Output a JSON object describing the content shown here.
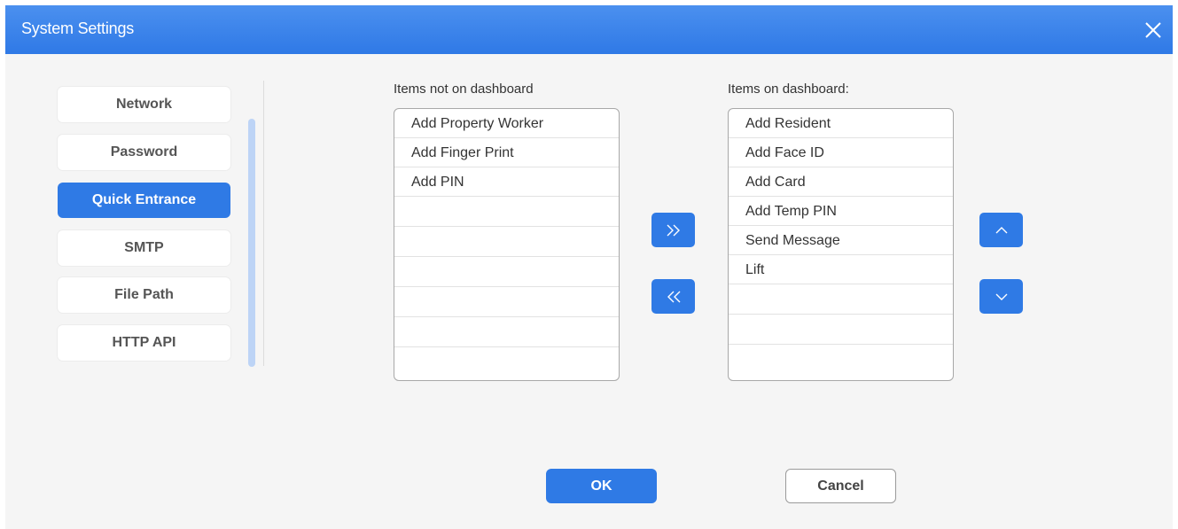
{
  "window": {
    "title": "System Settings"
  },
  "sidebar": {
    "items": [
      {
        "label": "Network",
        "active": false
      },
      {
        "label": "Password",
        "active": false
      },
      {
        "label": "Quick Entrance",
        "active": true
      },
      {
        "label": "SMTP",
        "active": false
      },
      {
        "label": "File Path",
        "active": false
      },
      {
        "label": "HTTP API",
        "active": false
      }
    ]
  },
  "lists": {
    "available": {
      "label": "Items not on dashboard",
      "items": [
        "Add Property Worker",
        "Add Finger Print",
        "Add PIN"
      ]
    },
    "dashboard": {
      "label": "Items on dashboard:",
      "items": [
        "Add Resident",
        "Add Face ID",
        "Add Card",
        "Add Temp PIN",
        "Send Message",
        "Lift"
      ]
    }
  },
  "buttons": {
    "ok_label": "OK",
    "cancel_label": "Cancel"
  },
  "icons": {
    "close": "close-icon",
    "add": "double-chevron-right-icon",
    "remove": "double-chevron-left-icon",
    "up": "chevron-up-icon",
    "down": "chevron-down-icon"
  },
  "colors": {
    "accent": "#2f7ae5",
    "titlebar": "#3a84ea"
  }
}
